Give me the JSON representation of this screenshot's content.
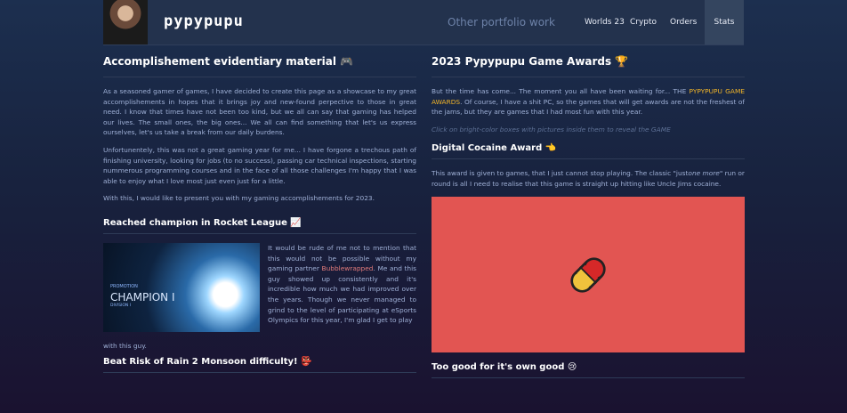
{
  "header": {
    "brand": "pypypupu",
    "portfolio_link": "Other portfolio work",
    "nav": [
      "Worlds 23",
      "Crypto",
      "Orders",
      "Stats"
    ]
  },
  "left": {
    "title": "Accomplishement evidentiary material 🎮",
    "intro1": "As a seasoned gamer of games, I have decided to create this page as a showcase to my great accomplishements in hopes that it brings joy and new-found perpective to those in great need. I know that times have not been too kind, but we all can say that gaming has helped our lives. The small ones, the big ones... We all can find something that let's us express ourselves, let's us take a break from our daily burdens.",
    "intro2": "Unfortunentely, this was not a great gaming year for me... I have forgone a trechous path of finishing university, looking for jobs (to no success), passing car technical inspections, starting nummerous programming courses and in the face of all those challenges I'm happy that I was able to enjoy what I love most just even just for a little.",
    "intro3": "With this, I would like to present you with my gaming accomplishements for 2023.",
    "rl_title": "Reached champion in Rocket League 📈",
    "rl_promo": "PROMOTION",
    "rl_champion": "CHAMPION I",
    "rl_division": "DIVISION I",
    "rl_text_a": "It would be rude of me not to mention that this would not be possible without my gaming partner",
    "rl_partner": "Bubblewrapped",
    "rl_text_b": ". Me and this guy showed up consistently and it's incredible how much we had improved over the years. Though we never managed to grind to the level of participating at eSports Olympics for this year, I'm glad I get to play",
    "rl_text_c": "with this guy.",
    "ror_title": "Beat Risk of Rain 2 Monsoon difficulty! 👺"
  },
  "right": {
    "title": "2023 Pypypupu Game Awards 🏆",
    "intro_a": "But the time has come... The moment you all have been waiting for... THE",
    "intro_hl": "PYPYPUPU GAME AWARDS",
    "intro_b": ". Of course, I have a shit PC, so the games that will get awards are not the freshest of the jams, but they are games that I had most fun with this year.",
    "click_note": "Click on bright-color boxes with pictures inside them to reveal the GAME",
    "award1_title": "Digital Cocaine Award 👈",
    "award1_text_a": "This award is given to games, that I just cannot stop playing. The classic \"just",
    "award1_text_em": "one more",
    "award1_text_b": "\" run or round is all I need to realise that this game is straight up hitting like Uncle Jims cocaine.",
    "award2_title": "Too good for it's own good 😢"
  },
  "colors": {
    "accent_red": "#e25552",
    "highlight": "#f0b429"
  },
  "icons": [
    "avatar-image",
    "pill-icon"
  ]
}
